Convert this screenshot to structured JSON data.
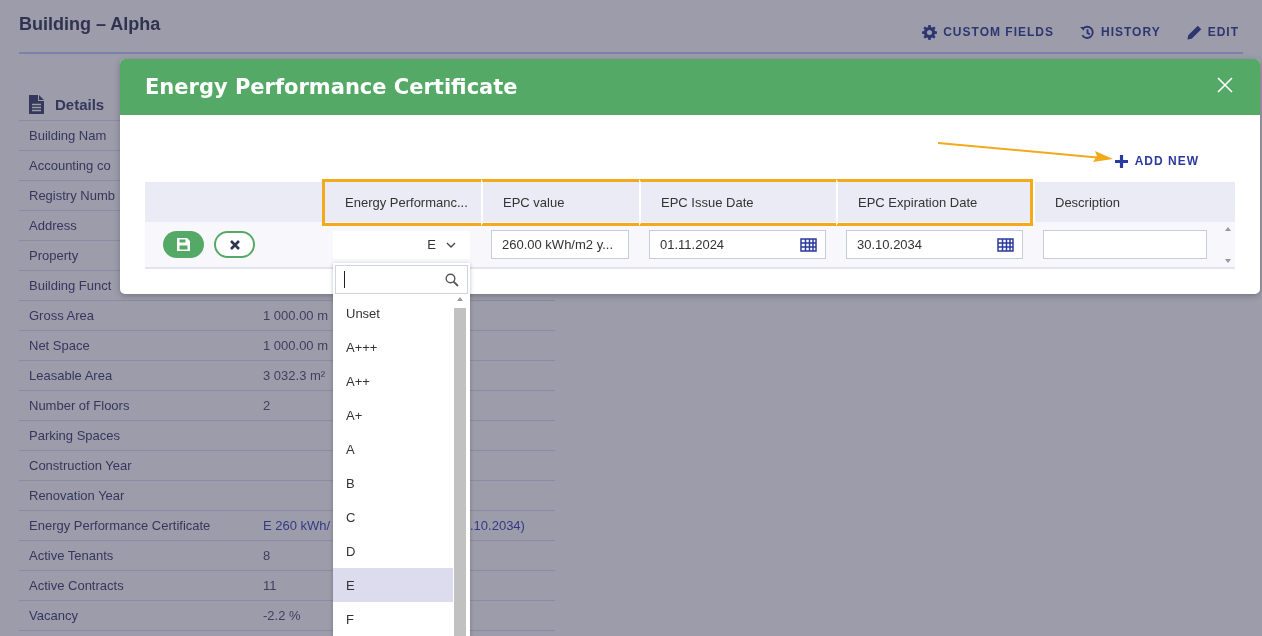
{
  "page": {
    "title": "Building – Alpha",
    "actions": [
      {
        "kind": "gear",
        "label": "CUSTOM FIELDS"
      },
      {
        "kind": "history",
        "label": "HISTORY"
      },
      {
        "kind": "edit",
        "label": "EDIT"
      }
    ],
    "details": {
      "heading": "Details",
      "rows": [
        {
          "label": "Building Nam"
        },
        {
          "label": "Accounting co"
        },
        {
          "label": "Registry Numb"
        },
        {
          "label": "Address"
        },
        {
          "label": "Property"
        },
        {
          "label": "Building Funct"
        },
        {
          "label": "Gross Area",
          "value": "1 000.00 m"
        },
        {
          "label": "Net Space",
          "value": "1 000.00 m"
        },
        {
          "label": "Leasable Area",
          "value": "3 032.3 m²"
        },
        {
          "label": "Number of Floors",
          "value": "2"
        },
        {
          "label": "Parking Spaces"
        },
        {
          "label": "Construction Year"
        },
        {
          "label": "Renovation Year"
        },
        {
          "label": "Energy Performance Certificate",
          "value": "E 260 kWh/",
          "value_tail": ".10.2034)"
        },
        {
          "label": "Active Tenants",
          "value": "8"
        },
        {
          "label": "Active Contracts",
          "value": "11"
        },
        {
          "label": "Vacancy",
          "value": "-2.2 %"
        }
      ]
    }
  },
  "modal": {
    "title": "Energy Performance Certificate",
    "add_new": "ADD NEW",
    "columns": [
      {
        "label": "Energy Performanc...",
        "highlighted": true
      },
      {
        "label": "EPC value",
        "highlighted": true
      },
      {
        "label": "EPC Issue Date",
        "highlighted": true
      },
      {
        "label": "EPC Expiration Date",
        "highlighted": true
      },
      {
        "label": "Description",
        "highlighted": false
      }
    ],
    "row": {
      "class": "E",
      "value": "260.00  kWh/m2 y...",
      "issue_date": "01.11.2024",
      "expiration_date": "30.10.2034"
    },
    "dropdown": {
      "options": [
        {
          "label": "Unset",
          "selected": false
        },
        {
          "label": "A+++",
          "selected": false
        },
        {
          "label": "A++",
          "selected": false
        },
        {
          "label": "A+",
          "selected": false
        },
        {
          "label": "A",
          "selected": false
        },
        {
          "label": "B",
          "selected": false
        },
        {
          "label": "C",
          "selected": false
        },
        {
          "label": "D",
          "selected": false
        },
        {
          "label": "E",
          "selected": true
        },
        {
          "label": "F",
          "selected": false
        }
      ]
    }
  }
}
